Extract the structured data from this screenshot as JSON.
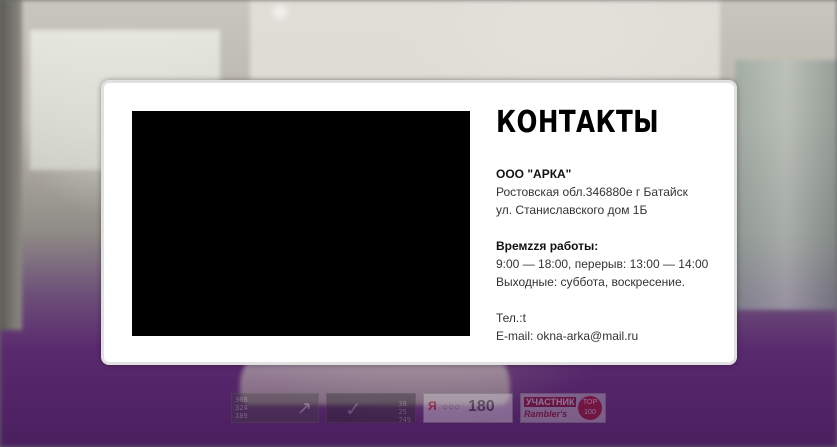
{
  "contacts": {
    "heading": "КОНТАКТЫ",
    "company": "ООО \"АРКА\"",
    "address_line1": "Ростовская обл.346880е г Батайск",
    "address_line2": "ул. Станиславского дом 1Б",
    "hours_title": "Времzzя работы:",
    "hours_line1": "9:00 — 18:00, перерыв: 13:00 — 14:00",
    "hours_line2": "Выходные:  суббота, воскресение.",
    "phone": "Тел.:t",
    "email": "E-mail: okna-arka@mail.ru"
  },
  "counters": {
    "liveinternet": {
      "digits": [
        "360",
        "324",
        "189"
      ],
      "icon": "arrow-up-right-icon"
    },
    "second": {
      "digits": [
        "38",
        "25",
        "749"
      ]
    },
    "yandex": {
      "logo": "Я",
      "value": "180"
    },
    "rambler": {
      "line1": "УЧАСТНИК",
      "line2": "Rambler's",
      "badge": "TOP 100"
    }
  },
  "colors": {
    "panel_bg": "#ffffff",
    "map_bg": "#000000",
    "text": "#333333",
    "heading": "#000000"
  }
}
